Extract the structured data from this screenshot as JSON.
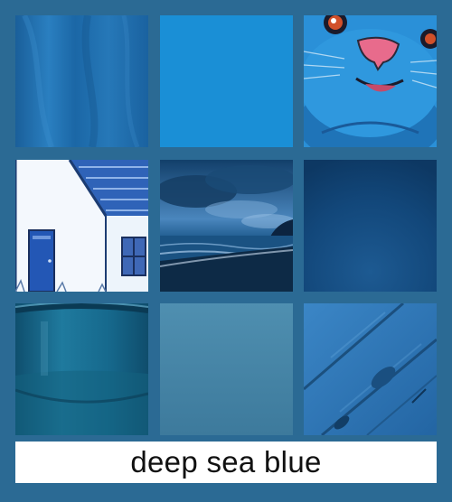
{
  "caption": {
    "text": "deep sea blue"
  },
  "palette": {
    "background": "#2b6a94",
    "caption_background": "#ffffff",
    "caption_text": "#111111"
  },
  "tiles": [
    {
      "name": "fabric-tile",
      "color": "#1f6fae"
    },
    {
      "name": "solid-azure-tile",
      "color": "#1a8fd6"
    },
    {
      "name": "blue-cat-tile",
      "color": "#2a8fd8"
    },
    {
      "name": "white-cottage-tile",
      "color": "#3b6fc0"
    },
    {
      "name": "night-seascape-tile",
      "color": "#1d4f80"
    },
    {
      "name": "dark-gradient-tile",
      "color": "#10426f"
    },
    {
      "name": "ceramic-mug-tile",
      "color": "#1a6a8e"
    },
    {
      "name": "muted-steel-tile",
      "color": "#4a88a8"
    },
    {
      "name": "wooden-plank-tile",
      "color": "#2f77b5"
    }
  ]
}
